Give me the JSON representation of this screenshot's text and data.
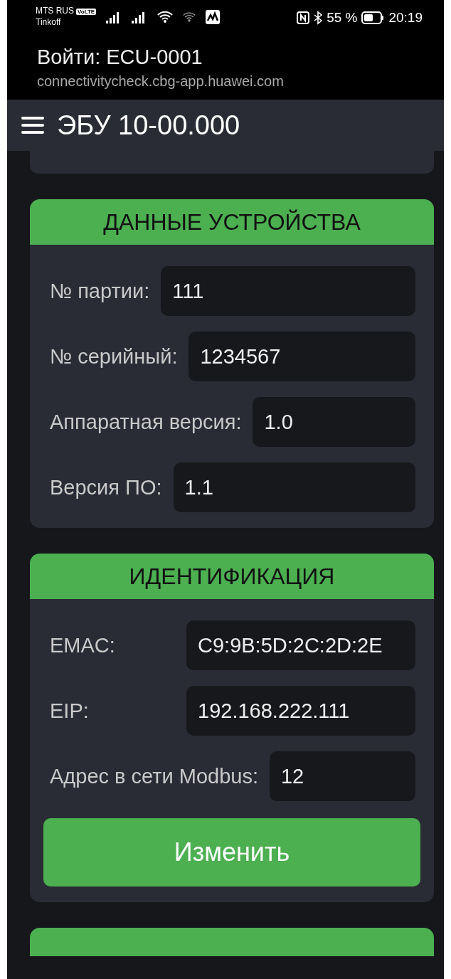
{
  "status_bar": {
    "carrier": "MTS RUS",
    "carrier_badge": "VoLTE",
    "carrier_2": "Tinkoff",
    "battery": "55 %",
    "time": "20:19"
  },
  "login_header": {
    "title": "Войти: ECU-0001",
    "url": "connectivitycheck.cbg-app.huawei.com"
  },
  "app_bar": {
    "title": "ЭБУ 10-00.000"
  },
  "sections": [
    {
      "title": "ДАННЫЕ УСТРОЙСТВА",
      "fields": [
        {
          "kind": "inline",
          "label": "№ партии:",
          "value": "111"
        },
        {
          "kind": "inline",
          "label": "№ серийный:",
          "value": "1234567"
        },
        {
          "kind": "inline",
          "label": "Аппаратная версия:",
          "value": "1.0"
        },
        {
          "kind": "inline",
          "label": "Версия ПО:",
          "value": "1.1"
        }
      ]
    },
    {
      "title": "ИДЕНТИФИКАЦИЯ",
      "fields": [
        {
          "kind": "aligned",
          "label": "EMAC:",
          "value": "C9:9B:5D:2C:2D:2E"
        },
        {
          "kind": "aligned",
          "label": "EIP:",
          "value": "192.168.222.111"
        },
        {
          "kind": "inline",
          "label": "Адрес в сети Modbus:",
          "value": "12"
        }
      ],
      "button": "Изменить"
    }
  ]
}
